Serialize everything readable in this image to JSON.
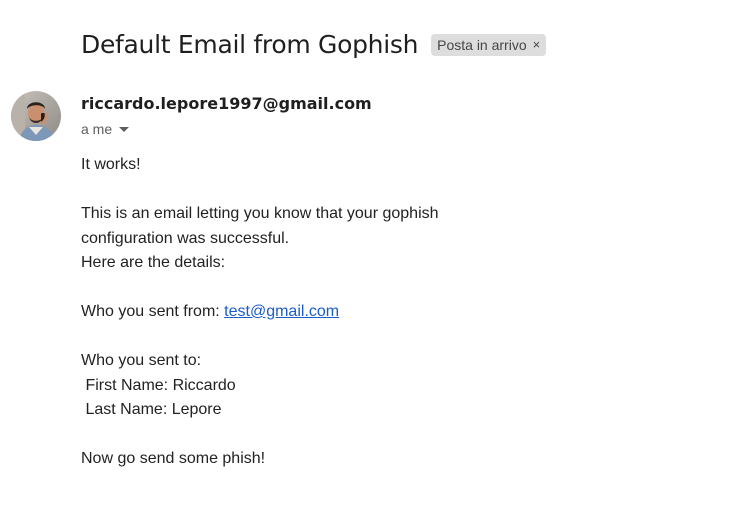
{
  "header": {
    "subject": "Default Email from Gophish",
    "label": "Posta in arrivo",
    "label_close": "×"
  },
  "message": {
    "sender": "riccardo.lepore1997@gmail.com",
    "recipient": "a me",
    "avatar_icon": "user-avatar-photo",
    "body": {
      "line1": "It works!",
      "line2": "This is an email letting you know that your gophish",
      "line3": "configuration was successful.",
      "line4": "Here are the details:",
      "from_label": "Who you sent from: ",
      "from_email": "test@gmail.com",
      "to_label": "Who you sent to:",
      "first_name": " First Name: Riccardo",
      "last_name": " Last Name: Lepore",
      "closing": "Now go send some phish!"
    }
  },
  "colors": {
    "link": "#1a5cc8",
    "chip_bg": "#dddddd",
    "text": "#222222"
  }
}
